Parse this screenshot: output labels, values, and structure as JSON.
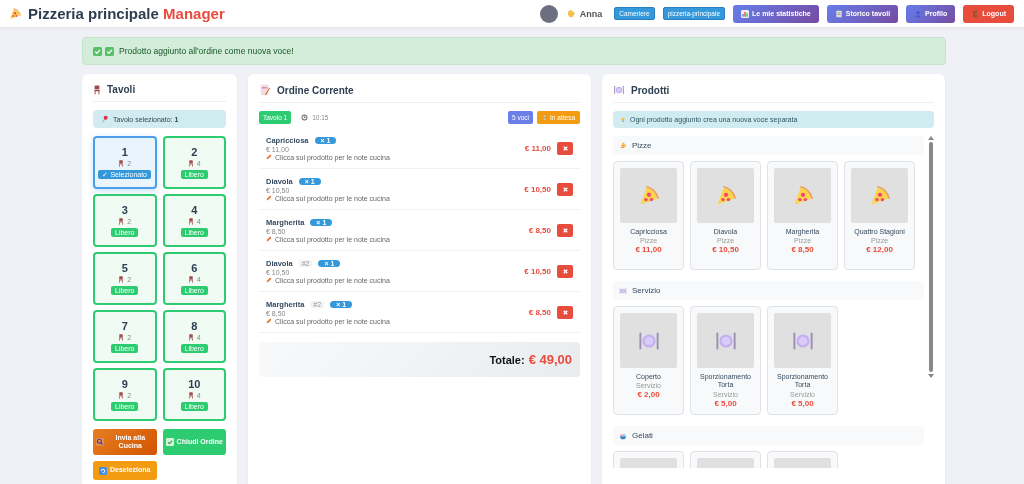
{
  "header": {
    "logo_title": "Pizzeria principale",
    "logo_accent": "Manager",
    "user_name": "Anna",
    "badges": [
      "Cameriere",
      "pizzeria-principale"
    ],
    "buttons": [
      {
        "label": "Le mie statistiche",
        "kind": "stats"
      },
      {
        "label": "Storico tavoli",
        "kind": "history"
      },
      {
        "label": "Profilo",
        "kind": "profile"
      },
      {
        "label": "Logout",
        "kind": "logout"
      }
    ]
  },
  "alert": {
    "message": "Prodotto aggiunto all'ordine come nuova voce!"
  },
  "tables_panel": {
    "title": "Tavoli",
    "selection_label": "Tavolo selezionato:",
    "selection_value": "1",
    "tables": [
      {
        "number": "1",
        "seats": "2",
        "status": "✓ Selezionato",
        "selected": true
      },
      {
        "number": "2",
        "seats": "4",
        "status": "Libero",
        "selected": false
      },
      {
        "number": "3",
        "seats": "2",
        "status": "Libero",
        "selected": false
      },
      {
        "number": "4",
        "seats": "4",
        "status": "Libero",
        "selected": false
      },
      {
        "number": "5",
        "seats": "2",
        "status": "Libero",
        "selected": false
      },
      {
        "number": "6",
        "seats": "4",
        "status": "Libero",
        "selected": false
      },
      {
        "number": "7",
        "seats": "2",
        "status": "Libero",
        "selected": false
      },
      {
        "number": "8",
        "seats": "4",
        "status": "Libero",
        "selected": false
      },
      {
        "number": "9",
        "seats": "2",
        "status": "Libero",
        "selected": false
      },
      {
        "number": "10",
        "seats": "4",
        "status": "Libero",
        "selected": false
      }
    ],
    "actions": [
      {
        "label": "Invia alla Cucina",
        "kind": "send"
      },
      {
        "label": "Chiudi Ordine",
        "kind": "close"
      },
      {
        "label": "Deseleziona",
        "kind": "deselect"
      }
    ]
  },
  "order_panel": {
    "title": "Ordine Corrente",
    "table_badge": "Tavolo 1",
    "time": "10:15",
    "count_badge": "5 voci",
    "status_badge": "In attesa",
    "items": [
      {
        "name": "Capricciosa",
        "quantity": "× 1",
        "unit_price": "€ 11,00",
        "note_hint": "Clicca sul prodotto per le note cucina",
        "price": "€ 11,00"
      },
      {
        "name": "Diavola",
        "quantity": "× 1",
        "unit_price": "€ 10,50",
        "note_hint": "Clicca sul prodotto per le note cucina",
        "price": "€ 10,50"
      },
      {
        "name": "Margherita",
        "quantity": "× 1",
        "unit_price": "€ 8,50",
        "note_hint": "Clicca sul prodotto per le note cucina",
        "price": "€ 8,50"
      },
      {
        "name": "Diavola",
        "tag": "#2",
        "quantity": "× 1",
        "unit_price": "€ 10,50",
        "note_hint": "Clicca sul prodotto per le note cucina",
        "price": "€ 10,50"
      },
      {
        "name": "Margherita",
        "tag": "#2",
        "quantity": "× 1",
        "unit_price": "€ 8,50",
        "note_hint": "Clicca sul prodotto per le note cucina",
        "price": "€ 8,50"
      }
    ],
    "total_label": "Totale:",
    "total_value": "€ 49,00"
  },
  "products_panel": {
    "title": "Prodotti",
    "info": "Ogni prodotto aggiunto crea una nuova voce separata",
    "categories": [
      {
        "name": "Pizze",
        "kind": "pizza",
        "products": [
          {
            "kind": "pizza",
            "name": "Capricciosa",
            "category": "Pizze",
            "price": "€ 11,00"
          },
          {
            "kind": "pizza",
            "name": "Diavola",
            "category": "Pizze",
            "price": "€ 10,50"
          },
          {
            "kind": "pizza",
            "name": "Margherita",
            "category": "Pizze",
            "price": "€ 8,50"
          },
          {
            "kind": "pizza",
            "name": "Quattro Stagioni",
            "category": "Pizze",
            "price": "€ 12,00"
          }
        ]
      },
      {
        "name": "Servizio",
        "kind": "plate",
        "products": [
          {
            "kind": "plate",
            "name": "Coperto",
            "category": "Servizio",
            "price": "€ 2,00"
          },
          {
            "kind": "plate",
            "name": "Sporzionamento Torta",
            "category": "Servizio",
            "price": "€ 5,00"
          },
          {
            "kind": "plate",
            "name": "Sporzionamento Torta",
            "category": "Servizio",
            "price": "€ 5,00"
          }
        ]
      },
      {
        "name": "Gelati",
        "kind": "icecream",
        "products": [
          {
            "kind": "cut"
          },
          {
            "kind": "cut"
          },
          {
            "kind": "cut"
          }
        ]
      }
    ]
  }
}
